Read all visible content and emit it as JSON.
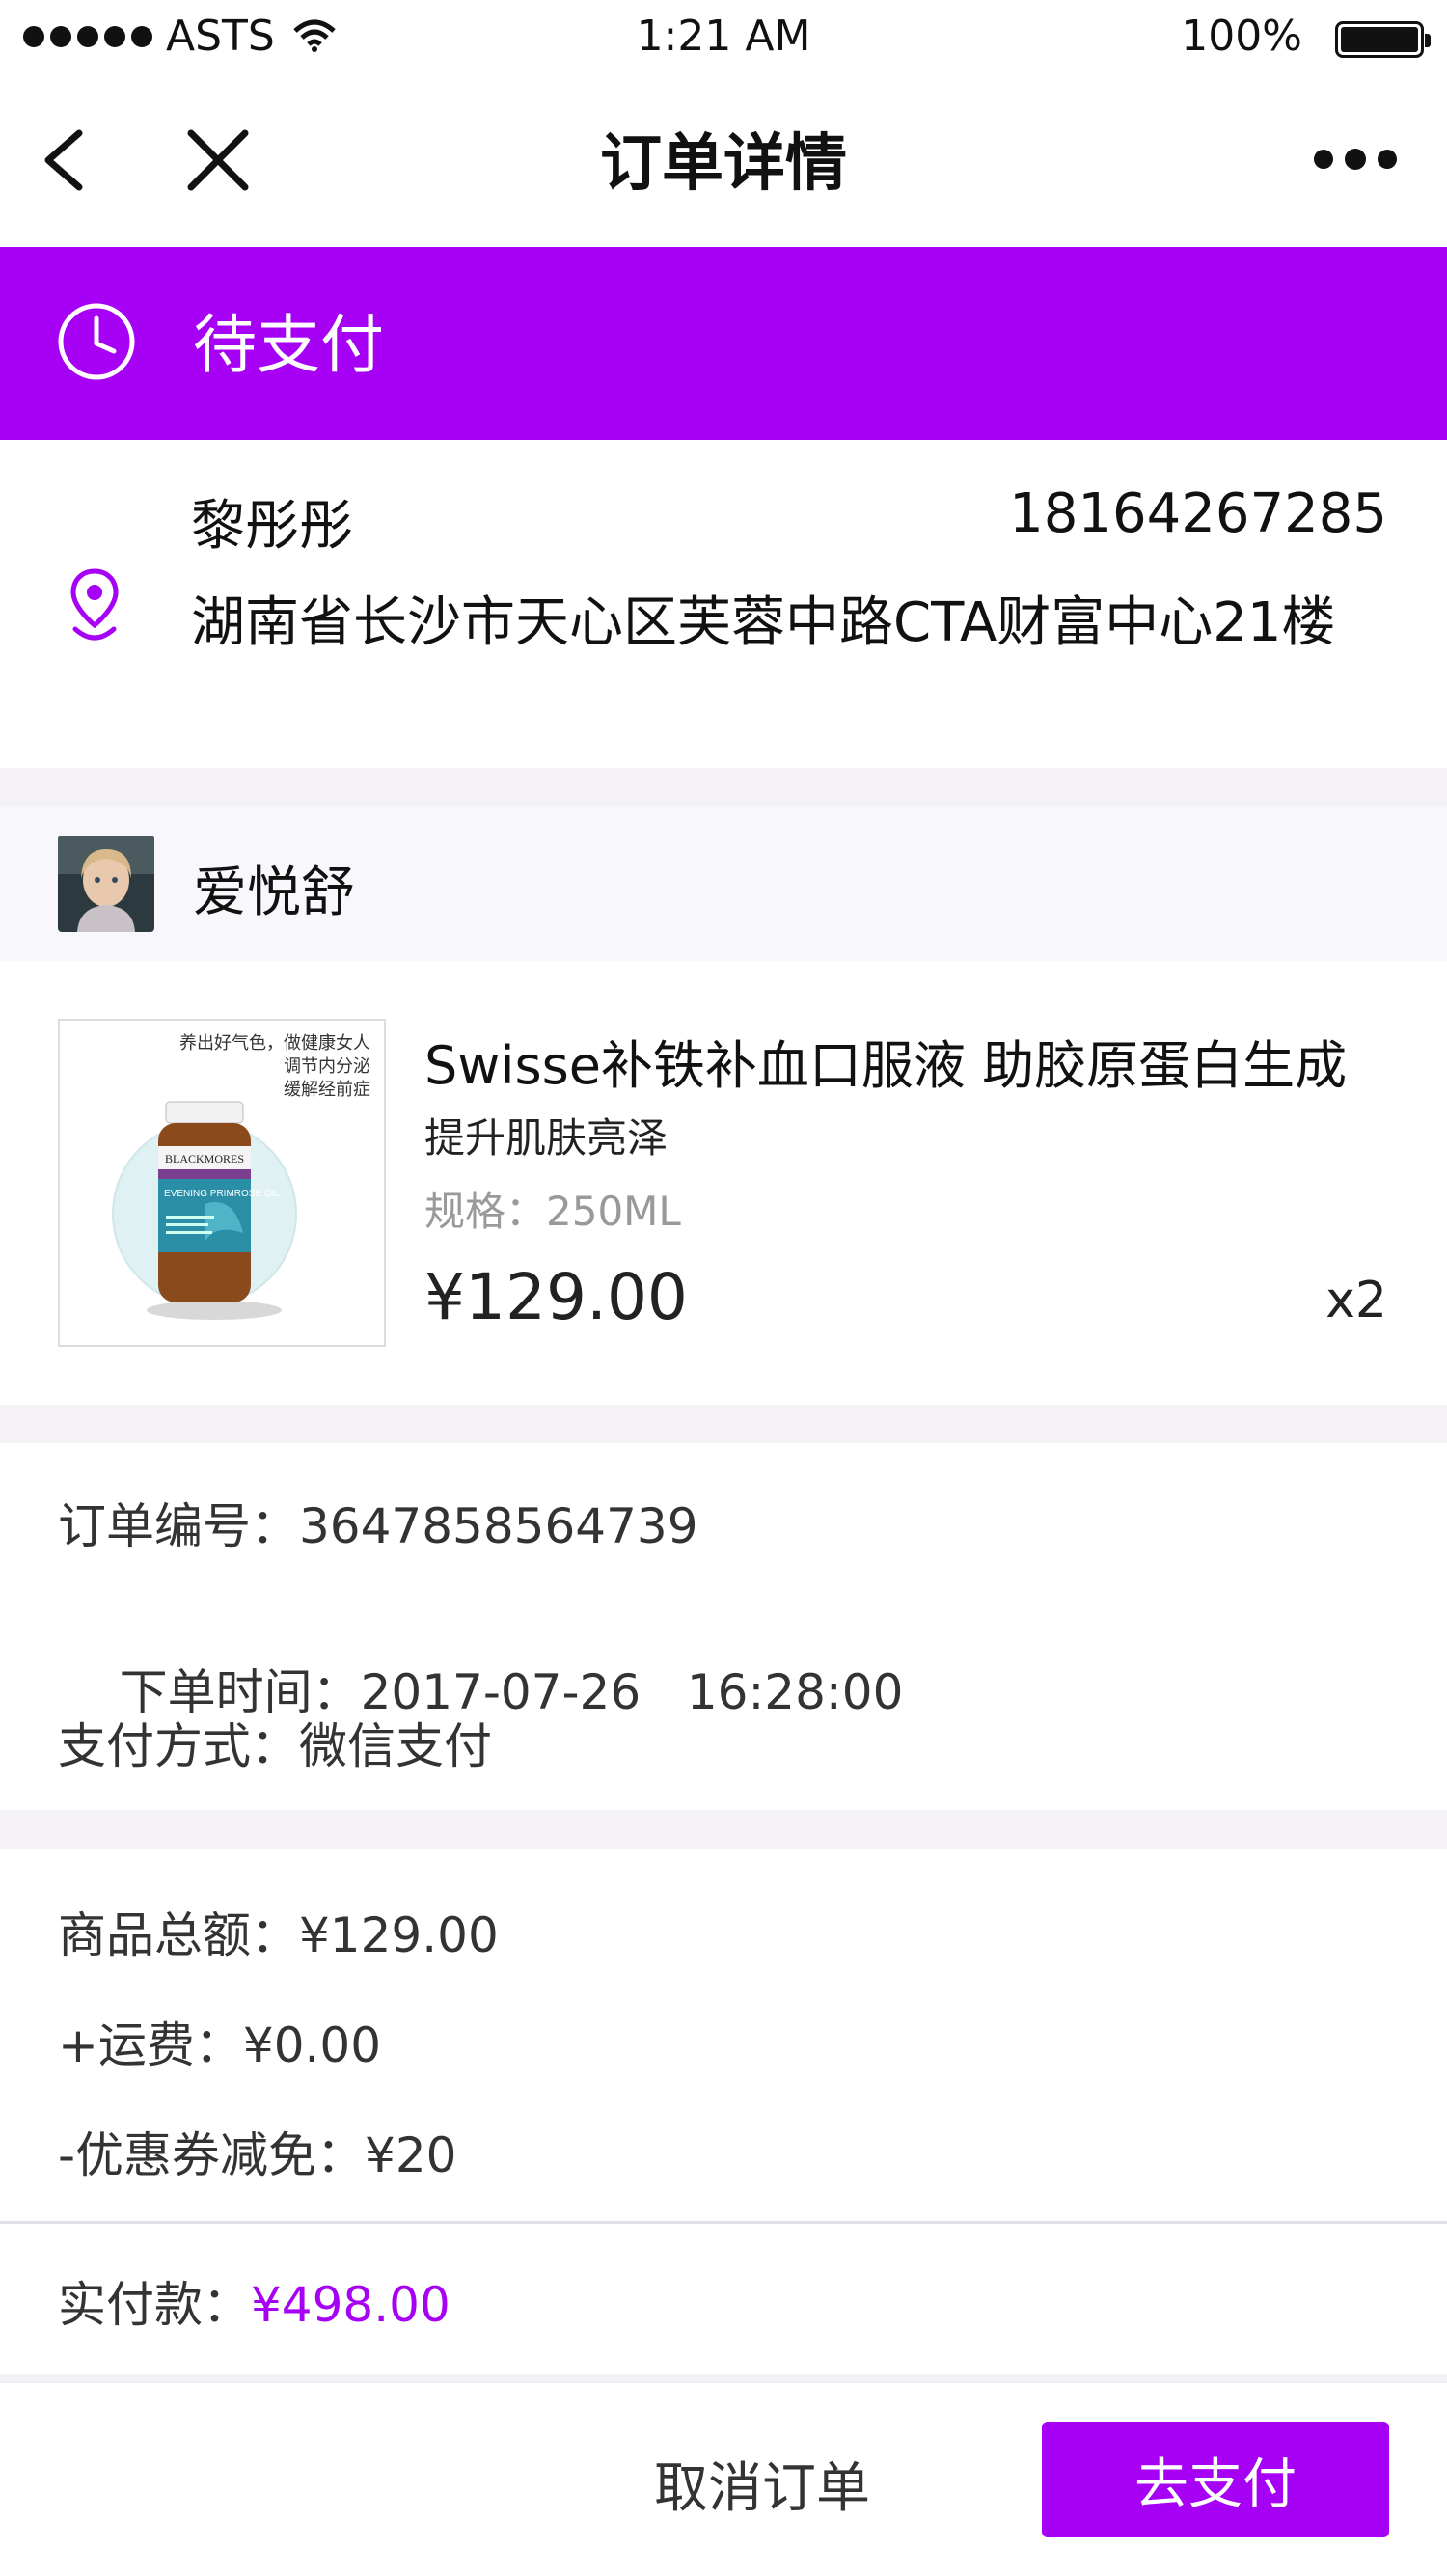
{
  "status_bar": {
    "carrier": "ASTS",
    "time": "1:21 AM",
    "battery": "100%"
  },
  "nav": {
    "title": "订单详情",
    "icons": [
      "back-icon",
      "close-icon",
      "more-icon"
    ]
  },
  "order_status": {
    "label": "待支付",
    "icon": "clock-icon",
    "color": "#a701f5"
  },
  "address": {
    "name": "黎彤彤",
    "phone": "18164267285",
    "detail": "湖南省长沙市天心区芙蓉中路CTA财富中心21楼",
    "icon": "location-pin-icon"
  },
  "shop": {
    "name": "爱悦舒"
  },
  "product": {
    "title": "Swisse补铁补血口服液 助胶原蛋白生成",
    "subtitle": "提升肌肤亮泽",
    "spec": "规格：250ML",
    "price": "¥129.00",
    "qty": "x2",
    "image_text": [
      "养出好气色，做健康女人",
      "调节内分泌",
      "缓解经前症"
    ],
    "image_brand": "BLACKMORES",
    "image_product": "EVENING PRIMROSE OIL"
  },
  "order_info": {
    "order_no_label": "订单编号：",
    "order_no": "3647858564739",
    "time_label": "下单时间：",
    "time": "2017-07-26   16:28:00",
    "pay_label": "支付方式：",
    "pay": "微信支付"
  },
  "amounts": {
    "goods_label": "商品总额：",
    "goods": "¥129.00",
    "shipping_label": "+运费：",
    "shipping": "¥0.00",
    "coupon_label": "-优惠券减免：",
    "coupon": "¥20",
    "paid_label": "实付款：",
    "paid": "¥498.00"
  },
  "actions": {
    "cancel": "取消订单",
    "pay": "去支付"
  }
}
